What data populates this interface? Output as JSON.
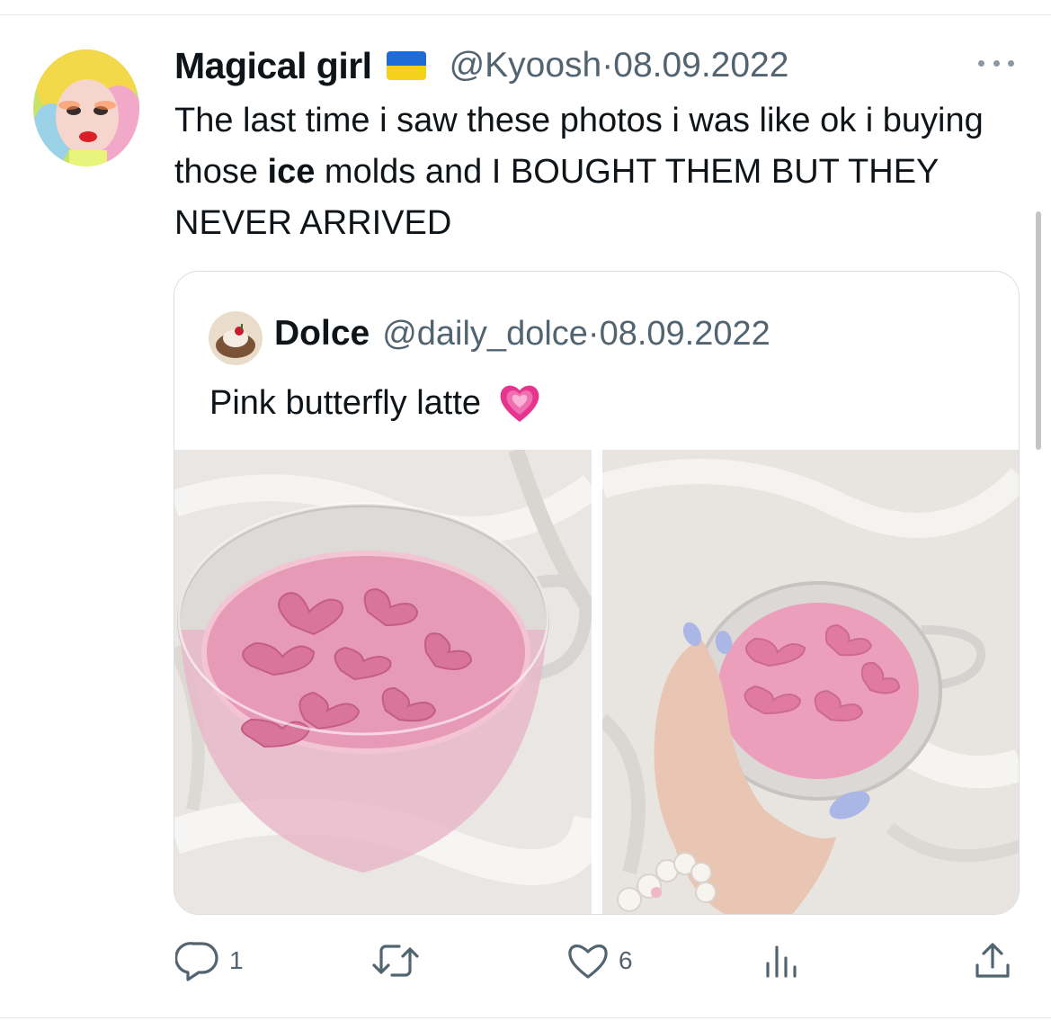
{
  "tweet": {
    "author": {
      "display_name": "Magical girl",
      "flag_icon": "ukraine-flag-icon",
      "handle": "@Kyoosh",
      "separator": "·",
      "date": "08.09.2022"
    },
    "text_parts": [
      {
        "text": "The last time i saw these photos i was like ok i buying those ",
        "bold": false
      },
      {
        "text": "ice",
        "bold": true
      },
      {
        "text": " molds and I BOUGHT THEM BUT THEY NEVER ARRIVED",
        "bold": false
      }
    ]
  },
  "quoted_tweet": {
    "author": {
      "display_name": "Dolce",
      "handle": "@daily_dolce",
      "separator": "·",
      "date": "08.09.2022"
    },
    "text": "Pink butterfly latte",
    "emoji_icon": "growing-heart-emoji",
    "photos": [
      {
        "name": "pink-latte-cup-photo"
      },
      {
        "name": "hand-holding-pink-latte-photo"
      }
    ]
  },
  "actions": {
    "reply": {
      "icon": "reply-icon",
      "count": "1"
    },
    "retweet": {
      "icon": "retweet-icon",
      "count": ""
    },
    "like": {
      "icon": "heart-icon",
      "count": "6"
    },
    "views": {
      "icon": "views-icon",
      "count": ""
    },
    "share": {
      "icon": "share-icon",
      "count": ""
    }
  },
  "colors": {
    "text": "#0f1419",
    "secondary_text": "#536471",
    "border": "#d9dee2",
    "icon": "#536471",
    "latte_pink": "#e79ab6"
  }
}
